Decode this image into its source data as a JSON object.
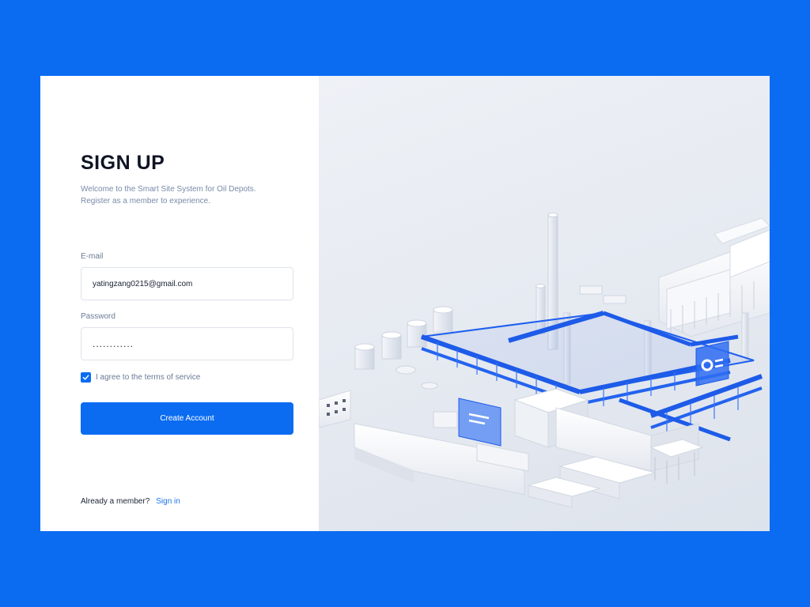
{
  "form": {
    "title": "SIGN UP",
    "subtitle_line1": "Welcome to the Smart Site System for Oil Depots.",
    "subtitle_line2": "Register as a member to experience.",
    "email_label": "E-mail",
    "email_value": "yatingzang0215@gmail.com",
    "password_label": "Password",
    "password_value": "............",
    "terms_checked": true,
    "terms_label": "I agree to the terms of service",
    "submit_label": "Create Account",
    "footer_text": "Already a member?",
    "signin_label": "Sign in"
  },
  "colors": {
    "accent": "#0b6cf2",
    "background": "#0b6cf2",
    "card": "#ffffff",
    "title_text": "#0e1424",
    "muted_text": "#7a8aa8",
    "link": "#1a74e8"
  },
  "icons": {
    "checkbox": "check-icon"
  }
}
